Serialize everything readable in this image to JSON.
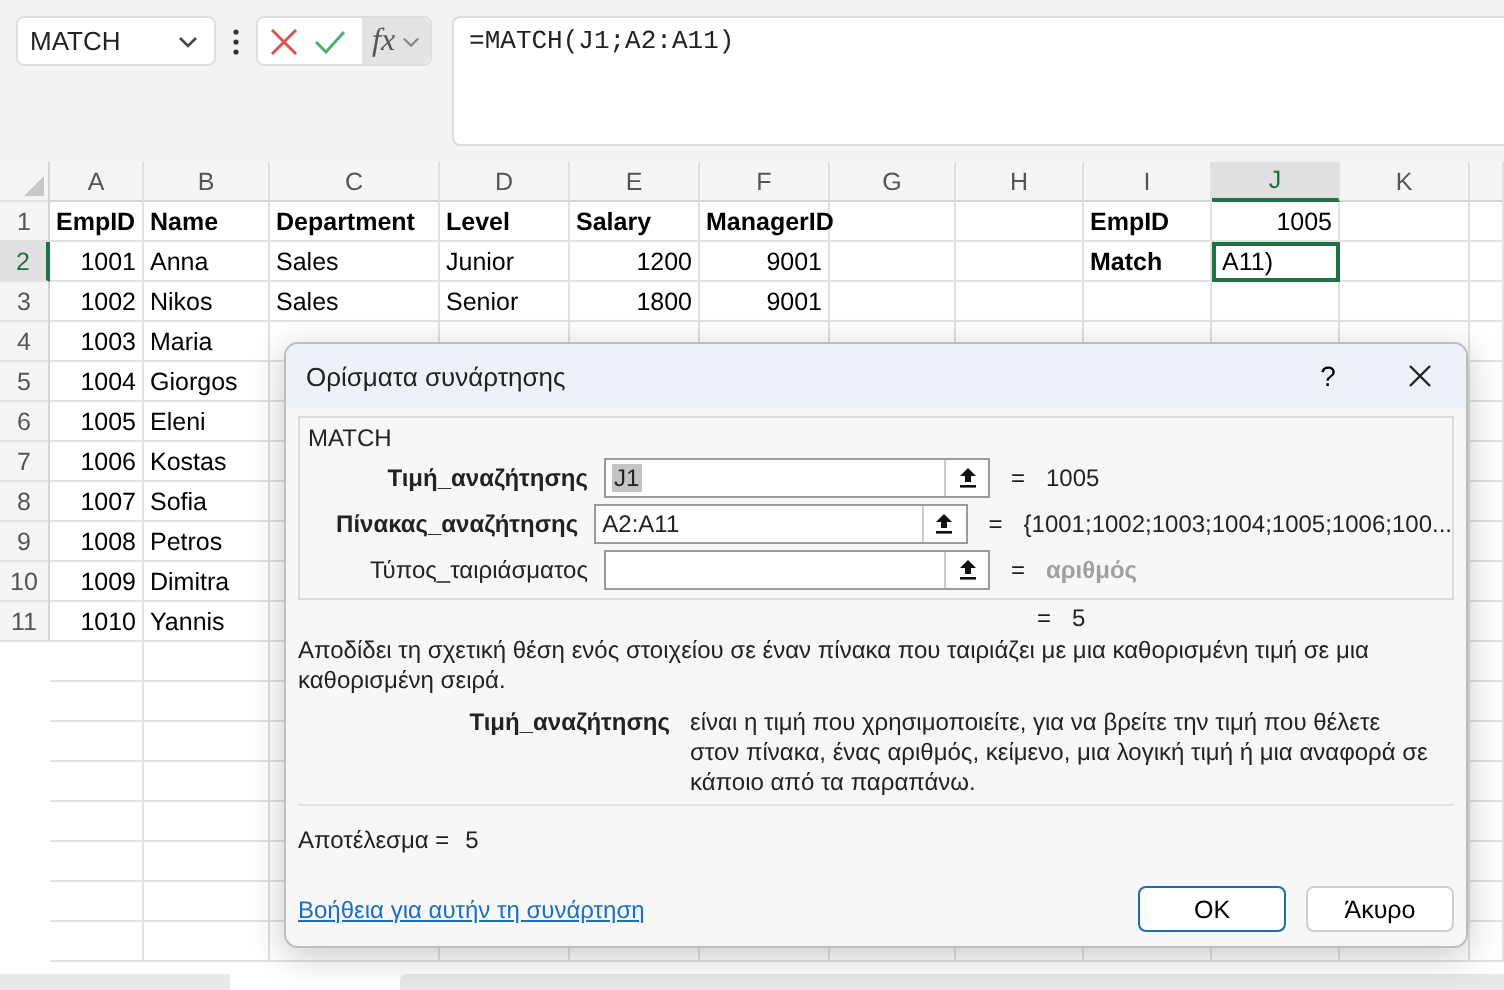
{
  "name_box": {
    "value": "MATCH"
  },
  "formula_toolbar": {
    "function_button": "fx"
  },
  "formula_bar": {
    "value": "=MATCH(J1;A2:A11)"
  },
  "sheet": {
    "columns": [
      {
        "label": "A",
        "selected": false
      },
      {
        "label": "B",
        "selected": false
      },
      {
        "label": "C",
        "selected": false
      },
      {
        "label": "D",
        "selected": false
      },
      {
        "label": "E",
        "selected": false
      },
      {
        "label": "F",
        "selected": false
      },
      {
        "label": "G",
        "selected": false
      },
      {
        "label": "H",
        "selected": false
      },
      {
        "label": "I",
        "selected": false
      },
      {
        "label": "J",
        "selected": true
      },
      {
        "label": "K",
        "selected": false
      }
    ],
    "rows": [
      {
        "header": "1",
        "selected": false,
        "cells": [
          {
            "text": "EmpID",
            "kind": "heading"
          },
          {
            "text": "Name",
            "kind": "heading"
          },
          {
            "text": "Department",
            "kind": "heading"
          },
          {
            "text": "Level",
            "kind": "heading"
          },
          {
            "text": "Salary",
            "kind": "heading"
          },
          {
            "text": "ManagerID",
            "kind": "heading"
          },
          null,
          null,
          {
            "text": "EmpID",
            "kind": "heading"
          },
          {
            "text": "1005",
            "kind": "number"
          },
          null
        ]
      },
      {
        "header": "2",
        "selected": true,
        "cells": [
          {
            "text": "1001",
            "kind": "number"
          },
          {
            "text": "Anna",
            "kind": "text"
          },
          {
            "text": "Sales",
            "kind": "text"
          },
          {
            "text": "Junior",
            "kind": "text"
          },
          {
            "text": "1200",
            "kind": "number"
          },
          {
            "text": "9001",
            "kind": "number"
          },
          null,
          null,
          {
            "text": "Match",
            "kind": "heading"
          },
          {
            "text": "A11)",
            "kind": "text",
            "active": true
          },
          null
        ]
      },
      {
        "header": "3",
        "selected": false,
        "cells": [
          {
            "text": "1002",
            "kind": "number"
          },
          {
            "text": "Nikos",
            "kind": "text"
          },
          {
            "text": "Sales",
            "kind": "text"
          },
          {
            "text": "Senior",
            "kind": "text"
          },
          {
            "text": "1800",
            "kind": "number"
          },
          {
            "text": "9001",
            "kind": "number"
          },
          null,
          null,
          null,
          null,
          null
        ]
      },
      {
        "header": "4",
        "selected": false,
        "cells": [
          {
            "text": "1003",
            "kind": "number"
          },
          {
            "text": "Maria",
            "kind": "text"
          }
        ]
      },
      {
        "header": "5",
        "selected": false,
        "cells": [
          {
            "text": "1004",
            "kind": "number"
          },
          {
            "text": "Giorgos",
            "kind": "text"
          }
        ]
      },
      {
        "header": "6",
        "selected": false,
        "cells": [
          {
            "text": "1005",
            "kind": "number"
          },
          {
            "text": "Eleni",
            "kind": "text"
          }
        ]
      },
      {
        "header": "7",
        "selected": false,
        "cells": [
          {
            "text": "1006",
            "kind": "number"
          },
          {
            "text": "Kostas",
            "kind": "text"
          }
        ]
      },
      {
        "header": "8",
        "selected": false,
        "cells": [
          {
            "text": "1007",
            "kind": "number"
          },
          {
            "text": "Sofia",
            "kind": "text"
          }
        ]
      },
      {
        "header": "9",
        "selected": false,
        "cells": [
          {
            "text": "1008",
            "kind": "number"
          },
          {
            "text": "Petros",
            "kind": "text"
          }
        ]
      },
      {
        "header": "10",
        "selected": false,
        "cells": [
          {
            "text": "1009",
            "kind": "number"
          },
          {
            "text": "Dimitra",
            "kind": "text"
          }
        ]
      },
      {
        "header": "11",
        "selected": false,
        "cells": [
          {
            "text": "1010",
            "kind": "number"
          },
          {
            "text": "Yannis",
            "kind": "text"
          }
        ]
      }
    ]
  },
  "dialog": {
    "title": "Ορίσματα συνάρτησης",
    "help_button": "?",
    "function_name": "MATCH",
    "arguments": [
      {
        "label": "Τιμή_αναζήτησης",
        "bold": true,
        "value": "J1",
        "highlighted": true,
        "equals": "=",
        "result": "1005",
        "muted": false
      },
      {
        "label": "Πίνακας_αναζήτησης",
        "bold": true,
        "value": "A2:A11",
        "highlighted": false,
        "equals": "=",
        "result": "{1001;1002;1003;1004;1005;1006;100...",
        "muted": false
      },
      {
        "label": "Τύπος_ταιριάσματος",
        "bold": false,
        "highlighted": false,
        "equals": "=",
        "result": "αριθμός",
        "muted": true
      }
    ],
    "formula_result": {
      "equals": "=",
      "value": "5"
    },
    "description": "Αποδίδει τη σχετική θέση ενός στοιχείου σε έναν πίνακα που ταιριάζει με μια καθορισμένη τιμή σε μια καθορισμένη σειρά.",
    "argument_help": {
      "label": "Τιμή_αναζήτησης",
      "text": "είναι η τιμή που χρησιμοποιείτε, για να βρείτε την τιμή που θέλετε στον πίνακα, ένας αριθμός, κείμενο, μια λογική τιμή ή μια αναφορά σε κάποιο από τα παραπάνω."
    },
    "result_label": "Αποτέλεσμα =",
    "result_value": "5",
    "help_link": "Βοήθεια για αυτήν τη συνάρτηση",
    "buttons": [
      {
        "label": "OK",
        "default": true
      },
      {
        "label": "Άκυρο",
        "default": false
      }
    ]
  }
}
